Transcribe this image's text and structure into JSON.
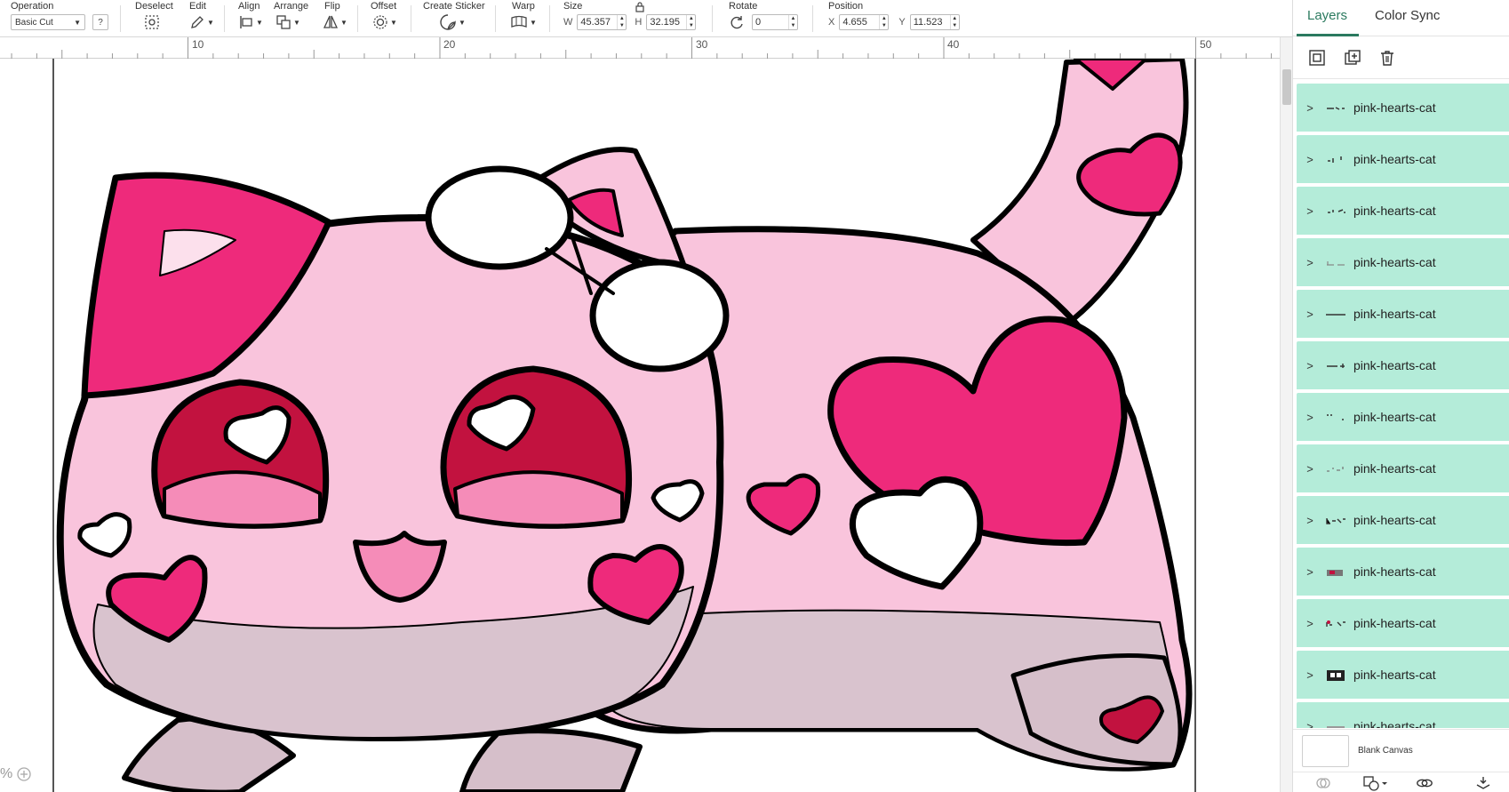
{
  "toolbar": {
    "operation": {
      "label": "Operation",
      "value": "Basic Cut",
      "help": "?"
    },
    "deselect": {
      "label": "Deselect"
    },
    "edit": {
      "label": "Edit"
    },
    "align": {
      "label": "Align"
    },
    "arrange": {
      "label": "Arrange"
    },
    "flip": {
      "label": "Flip"
    },
    "offset": {
      "label": "Offset"
    },
    "create_sticker": {
      "label": "Create Sticker"
    },
    "warp": {
      "label": "Warp"
    },
    "size": {
      "label": "Size",
      "w_label": "W",
      "w_value": "45.357",
      "h_label": "H",
      "h_value": "32.195"
    },
    "rotate": {
      "label": "Rotate",
      "value": "0"
    },
    "position": {
      "label": "Position",
      "x_label": "X",
      "x_value": "4.655",
      "y_label": "Y",
      "y_value": "11.523"
    }
  },
  "ruler": {
    "ticks": [
      "10",
      "20",
      "30",
      "40",
      "50"
    ]
  },
  "canvas": {
    "zoom_text": "%"
  },
  "panel": {
    "tabs": [
      "Layers",
      "Color Sync"
    ],
    "layers": [
      "pink-hearts-cat",
      "pink-hearts-cat",
      "pink-hearts-cat",
      "pink-hearts-cat",
      "pink-hearts-cat",
      "pink-hearts-cat",
      "pink-hearts-cat",
      "pink-hearts-cat",
      "pink-hearts-cat",
      "pink-hearts-cat",
      "pink-hearts-cat",
      "pink-hearts-cat",
      "pink-hearts-cat"
    ],
    "blank_canvas": "Blank Canvas"
  },
  "colors": {
    "accent": "#2b7a5f",
    "layer_row": "#b4ecd9",
    "cat_pink_light": "#f9c4dc",
    "cat_pink_mid": "#f58cb8",
    "cat_pink_hot": "#ee2a7b",
    "cat_crimson": "#c2123f",
    "cat_outline": "#000000",
    "cat_belly": "#d9c3ce"
  }
}
